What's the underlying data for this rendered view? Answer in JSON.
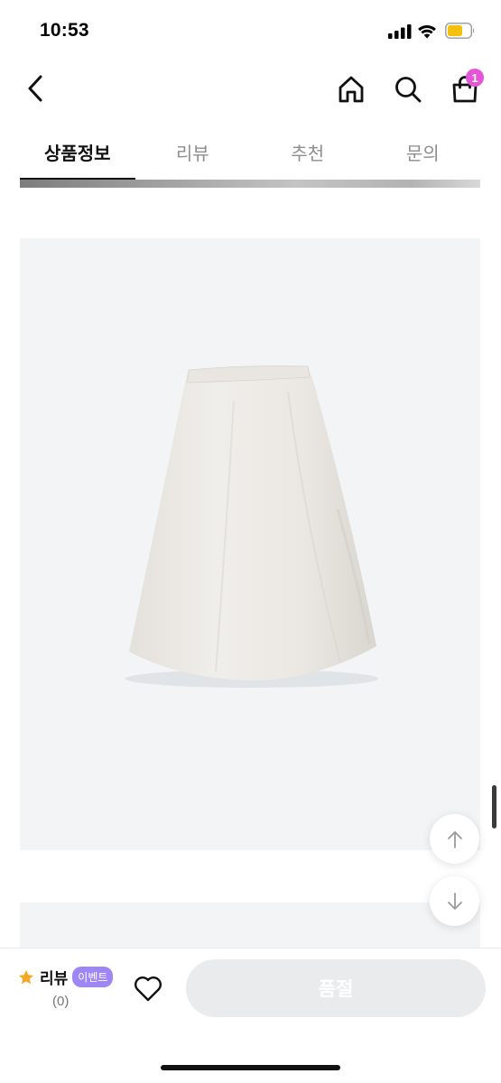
{
  "status_bar": {
    "time": "10:53"
  },
  "nav": {
    "back_icon": "chevron-left-icon",
    "home_icon": "home-icon",
    "search_icon": "search-icon",
    "cart_icon": "shopping-bag-icon",
    "cart_count": "1",
    "badge_color": "#e455d8"
  },
  "tabs": [
    {
      "label": "상품정보",
      "active": true
    },
    {
      "label": "리뷰",
      "active": false
    },
    {
      "label": "추천",
      "active": false
    },
    {
      "label": "문의",
      "active": false
    }
  ],
  "content": {
    "product_image": "white-satin-midi-skirt",
    "image_background": "#f2f4f6"
  },
  "float_buttons": {
    "up_icon": "arrow-up-icon",
    "down_icon": "arrow-down-icon"
  },
  "bottom_bar": {
    "review_label": "리뷰",
    "event_badge": "이벤트",
    "review_count": "(0)",
    "like_icon": "heart-icon",
    "action_label": "품절",
    "star_color": "#f5a623",
    "event_color": "#9e86f5"
  }
}
